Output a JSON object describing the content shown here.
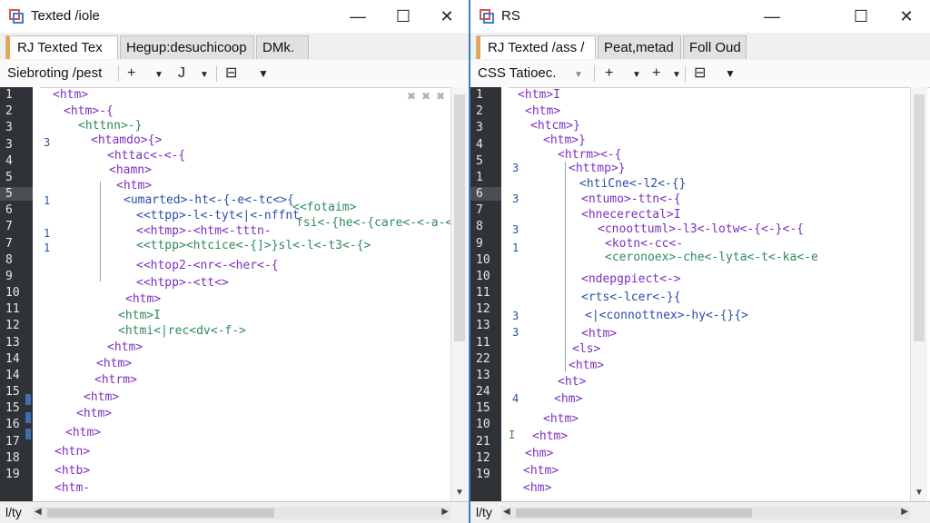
{
  "colors": {
    "accent": "#3c7fc4",
    "tag": "#7b2fbe",
    "green": "#2e8b57",
    "gutter": "#2f3236"
  },
  "left": {
    "title": "Texted /iole",
    "tabs": [
      "RJ Texted Tex",
      "Hegup:desuchicoop",
      "DMk."
    ],
    "toolbar": {
      "label": "Siebroting /pest",
      "b1": "+",
      "b2": "J",
      "b3": "⊟",
      "b4": "▼"
    },
    "lines": [
      "1",
      "2",
      "3",
      "3",
      "4",
      "5",
      "5",
      "6",
      "7",
      "7",
      "8",
      "9",
      "10",
      "11",
      "12",
      "13",
      "14",
      "14",
      "15",
      "15",
      "16",
      "17",
      "18",
      "19"
    ],
    "lane_nums": {
      "r3": "3",
      "r6": "1",
      "r7": "1",
      "r8": "1"
    },
    "code": [
      "<htm>",
      "<htm>-{",
      "<httnn>-}",
      "<htamdo>{>",
      "<httac<-<-{",
      "<hamn>",
      "<htm>",
      "<umarted>-ht<-{-e<-tc<>{",
      "<<ttpp>-l<-tyt<|<-nffnt",
      "<<htmp>-<htm<-tttn-",
      "<<ttpp><htcice<-{]>}sl<-l<-t3<-{>",
      "<<htop2-<nr<-<her<-{",
      "<<htpp>-<tt<>",
      "<htm>",
      "<htm>I",
      "<htmi<|rec<dv<-f->",
      "<htm>",
      "<htm>",
      "<htrm>",
      "<htm>",
      "<htm>",
      "<htm>",
      "<htn>",
      "<htb>",
      "<htm-"
    ],
    "overflow1": "<<fotaim>",
    "overflow2": "fsi<-{he<-{care<-<-a-<",
    "status": "l/ty"
  },
  "right": {
    "title": "RS",
    "tabs": [
      "RJ Texted /ass /",
      "Peat,metad",
      "Foll Oud"
    ],
    "toolbar": {
      "label": "CSS Tatioec.",
      "b1": "+",
      "b2": "+",
      "b3": "⊟",
      "b4": "▼"
    },
    "lines": [
      "1",
      "2",
      "3",
      "4",
      "5",
      "1",
      "6",
      "7",
      "8",
      "9",
      "10",
      "10",
      "11",
      "12",
      "13",
      "11",
      "22",
      "13",
      "24",
      "15",
      "10",
      "21",
      "12",
      "19"
    ],
    "lane_nums": {
      "r5": "3",
      "r7": "3",
      "r9": "3",
      "r10": "1",
      "r13": "3",
      "r14": "3",
      "r19": "4",
      "r21": "I"
    },
    "code": [
      "<htm>I",
      "<htm>",
      "<htcm>}",
      "<htm>}",
      "<htrm><-{",
      "<httmp>}",
      "<htiCne<-l2<-{}",
      "<ntumo>-ttn<-{",
      "<hnecerectal>I",
      "<cnoottuml>-l3<-lotw<-{<-}<-{",
      "<kotn<-cc<-",
      "<ceronoex>-che<-lyta<-t<-ka<-e",
      "<ndepgpiect<->",
      "<rts<-lcer<-}{",
      "<|<connottnex>-hy<-{}{>",
      "<htm>",
      "<ls>",
      "<htm>",
      "<ht>",
      "<hm>",
      "<htm>",
      "<htm>",
      "<hm>",
      "<htm>",
      "<hm>"
    ],
    "status": "l/ty"
  }
}
